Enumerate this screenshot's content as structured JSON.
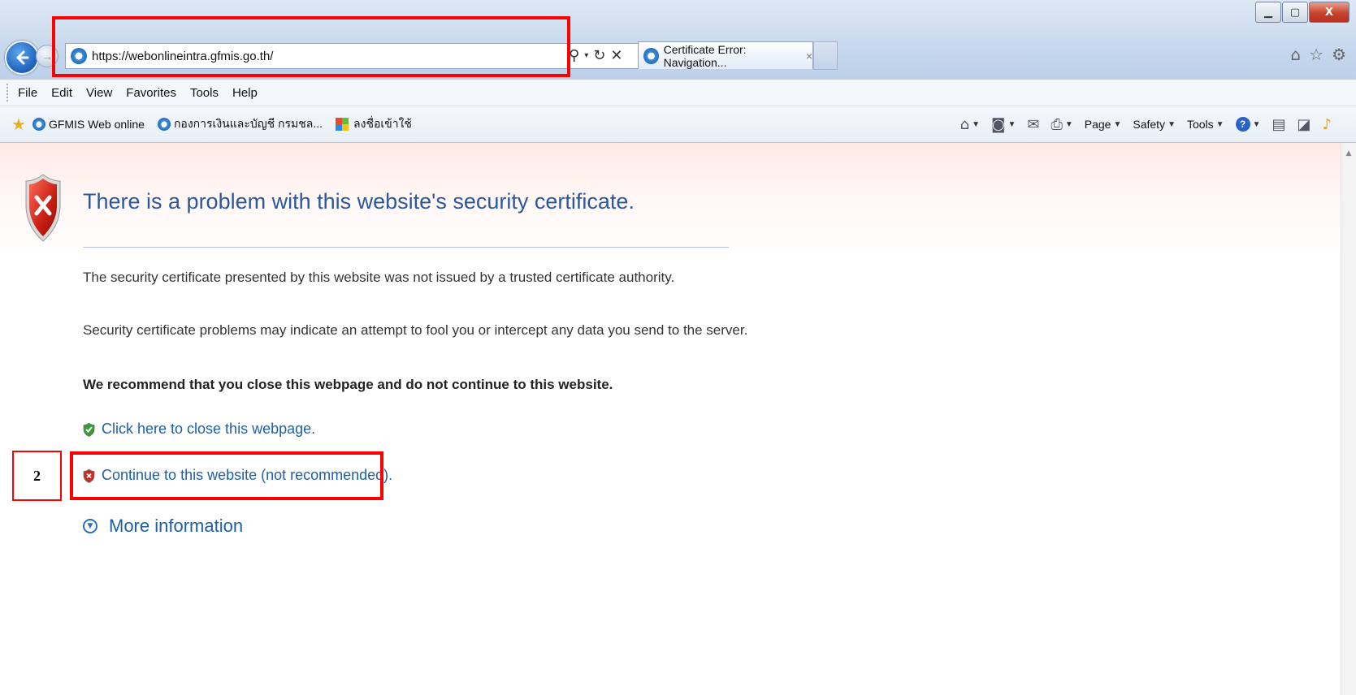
{
  "window": {
    "minimize_icon": "minimize-icon",
    "maximize_icon": "maximize-icon",
    "close_label": "X"
  },
  "nav": {
    "url": "https://webonlineintra.gfmis.go.th/",
    "tab_title": "Certificate Error: Navigation...",
    "tab_close": "×"
  },
  "menu": [
    "File",
    "Edit",
    "View",
    "Favorites",
    "Tools",
    "Help"
  ],
  "favorites": {
    "items": [
      {
        "label": "GFMIS Web online",
        "icon": "ie-icon"
      },
      {
        "label": "กองการเงินและบัญชี กรมชล...",
        "icon": "ie-icon"
      },
      {
        "label": "ลงชื่อเข้าใช้",
        "icon": "windows-icon"
      }
    ]
  },
  "commandbar": {
    "page": "Page",
    "safety": "Safety",
    "tools": "Tools"
  },
  "error": {
    "title": "There is a problem with this website's security certificate.",
    "p1": "The security certificate presented by this website was not issued by a trusted certificate authority.",
    "p2": "Security certificate problems may indicate an attempt to fool you or intercept any data you send to the server.",
    "recommend": "We recommend that you close this webpage and do not continue to this website.",
    "close_link": "Click here to close this webpage.",
    "continue_link": "Continue to this website (not recommended).",
    "more_info": "More information"
  },
  "annotation": {
    "step_number": "2",
    "highlight_color": "#ff0000"
  },
  "colors": {
    "title_blue": "#2b57a0",
    "link_blue": "#1e5fa8"
  }
}
